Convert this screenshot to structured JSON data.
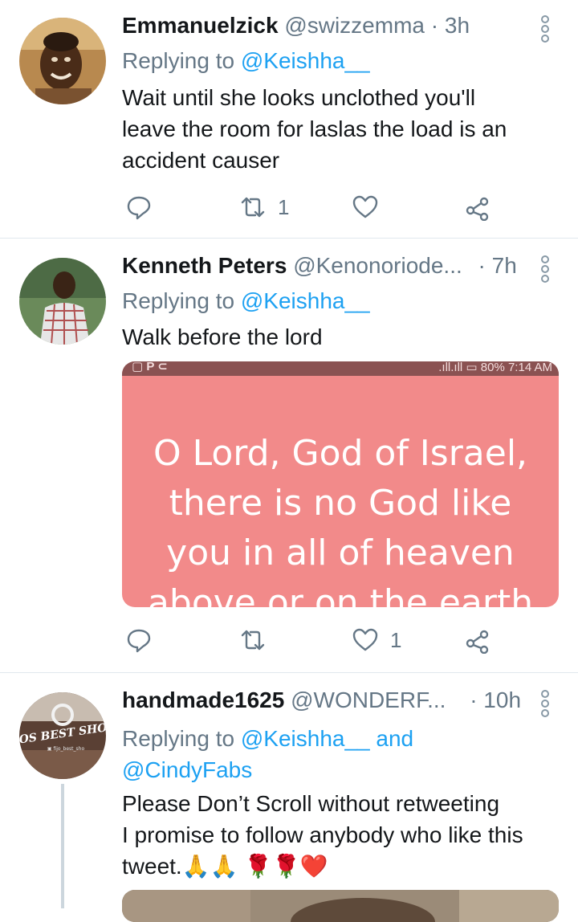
{
  "tweets": [
    {
      "name": "Emmanuelzick",
      "handle": "@swizzemma",
      "time": "· 3h",
      "replying_prefix": "Replying to",
      "replying_to": "@Keishha__",
      "text_lines": [
        "Wait until she looks unclothed you'll",
        "leave the room for laslas the load is an",
        "accident causer"
      ],
      "retweets": "1",
      "likes": ""
    },
    {
      "name": "Kenneth Peters",
      "handle": "@Kenonoriode...",
      "time": "· 7h",
      "replying_prefix": "Replying to",
      "replying_to": "@Keishha__",
      "text_lines": [
        "Walk before the lord"
      ],
      "media": {
        "status_bar": ".ıll.ıll ▭ 80% 7:14 AM",
        "lines": [
          "O Lord, God of Israel,",
          "there is no God like",
          "you in all of heaven",
          "above or on the earth"
        ],
        "bg_color": "#f28a8a",
        "bar_color": "#8a5252"
      },
      "retweets": "",
      "likes": "1"
    },
    {
      "name": "handmade1625",
      "handle": "@WONDERF...",
      "time": "· 10h",
      "replying_prefix": "Replying to",
      "replying_to": "@Keishha__ and",
      "replying_to_2": "@CindyFabs",
      "avatar_text": "FIJOS BEST SHOES",
      "text_lines": [
        "Please Don’t Scroll without retweeting",
        "I promise to follow anybody who like this",
        "tweet.🙏🙏 🌹🌹❤️"
      ]
    }
  ],
  "colors": {
    "link": "#1da1f2",
    "muted": "#657786",
    "text": "#14171a",
    "divider": "#e1e8ed"
  }
}
